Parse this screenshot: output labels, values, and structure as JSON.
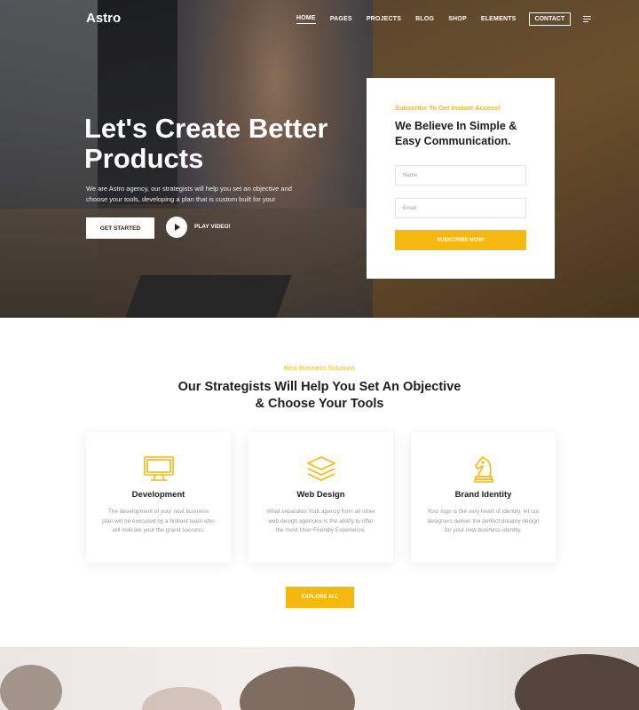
{
  "brand": {
    "logo": "Astro",
    "accent_color": "#f4b80f"
  },
  "nav": {
    "items": [
      "HOME",
      "PAGES",
      "PROJECTS",
      "BLOG",
      "SHOP",
      "ELEMENTS"
    ],
    "active": "HOME",
    "contact": "CONTACT",
    "menu_icon": "hamburger-menu-icon"
  },
  "hero": {
    "title": "Let's Create Better Products",
    "description": "We are Astro agency, our strategists will help you set an objective and choose your tools, developing a plan that is custom built for your",
    "cta_label": "GET STARTED",
    "play_label": "PLAY VIDEO!"
  },
  "subscribe": {
    "kicker": "Subscribe To Get Instant Access!",
    "title": "We Believe In  Simple & Easy Communication.",
    "name_placeholder": "Name",
    "email_placeholder": "Email",
    "button": "SUBSCRIBE NOW!"
  },
  "services": {
    "kicker": "Best Business Solutions",
    "title": "Our Strategists Will Help You Set An Objective & Choose Your Tools",
    "cards": [
      {
        "icon": "monitor-icon",
        "title": "Development",
        "description": "The development of your next business plan will be executed by a brilliant team who will indicate your the grand success."
      },
      {
        "icon": "layers-icon",
        "title": "Web Design",
        "description": "What separates York agency from all other web design agencies is the ability to offer the most User Friendly Experience."
      },
      {
        "icon": "chess-knight-icon",
        "title": "Brand Identity",
        "description": "Your logo is the very heart of  identity, let our designers deliver the perfect dreamy design for your new business identity."
      }
    ],
    "explore_button": "EXPLORE ALL"
  }
}
